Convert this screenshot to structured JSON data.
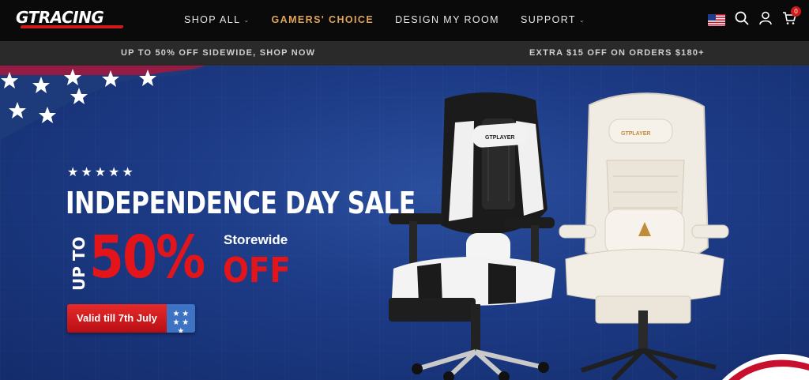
{
  "brand": {
    "logo_text": "GTRACING"
  },
  "nav": {
    "items": [
      {
        "label": "SHOP ALL",
        "has_dropdown": true,
        "active": false
      },
      {
        "label": "GAMERS' CHOICE",
        "has_dropdown": false,
        "active": true
      },
      {
        "label": "DESIGN MY ROOM",
        "has_dropdown": false,
        "active": false
      },
      {
        "label": "SUPPORT",
        "has_dropdown": true,
        "active": false
      }
    ],
    "icons": [
      "us-flag-icon",
      "search-icon",
      "account-icon",
      "cart-icon"
    ],
    "cart_count": "0",
    "accent_color": "#e0a458"
  },
  "promo_bar": {
    "left_text": "UP TO 50% OFF SIDEWIDE, SHOP NOW",
    "right_text": "EXTRA $15 OFF ON ORDERS $180+"
  },
  "hero": {
    "stars": "★★★★★",
    "title": "INDEPENDENCE DAY SALE",
    "up_to": "UP TO",
    "discount": "50%",
    "storewide": "Storewide",
    "off": "OFF",
    "cta_label": "Valid till 7th July",
    "chair_brand_1": "GTPLAYER",
    "chair_brand_2": "GTPLAYER",
    "colors": {
      "background": "#1c3a85",
      "accent_red": "#e3151b"
    }
  }
}
